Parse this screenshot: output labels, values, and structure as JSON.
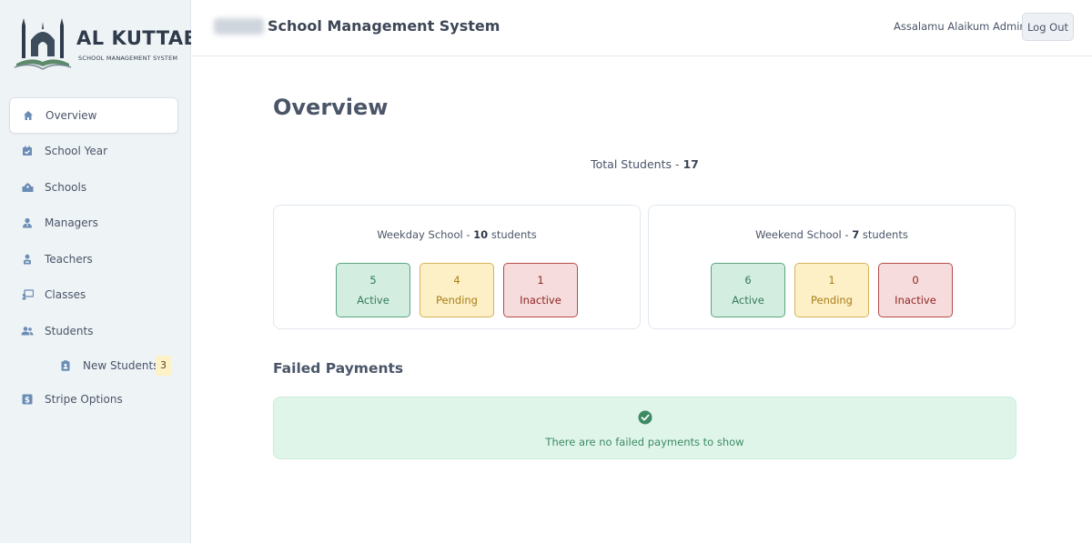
{
  "brand": {
    "name": "AL KUTTAB",
    "subtitle": "SCHOOL MANAGEMENT SYSTEM"
  },
  "sidebar": {
    "items": [
      {
        "label": "Overview",
        "icon": "home-icon",
        "active": true
      },
      {
        "label": "School Year",
        "icon": "calendar-icon"
      },
      {
        "label": "Schools",
        "icon": "school-icon"
      },
      {
        "label": "Managers",
        "icon": "user-tie-icon"
      },
      {
        "label": "Teachers",
        "icon": "teacher-icon"
      },
      {
        "label": "Classes",
        "icon": "chalkboard-icon"
      },
      {
        "label": "Students",
        "icon": "users-icon"
      },
      {
        "label": "New Students",
        "icon": "clipboard-user-icon",
        "badge": "3",
        "sub": true
      },
      {
        "label": "Stripe Options",
        "icon": "dollar-icon"
      }
    ]
  },
  "header": {
    "title": "School Management System",
    "greeting": "Assalamu Alaikum Admin",
    "logout_label": "Log Out"
  },
  "overview": {
    "title": "Overview",
    "total_label": "Total Students - ",
    "total_value": "17",
    "weekday": {
      "label": "Weekday School - ",
      "count": "10",
      "suffix": " students",
      "active": "5",
      "pending": "4",
      "inactive": "1"
    },
    "weekend": {
      "label": "Weekend School - ",
      "count": "7",
      "suffix": " students",
      "active": "6",
      "pending": "1",
      "inactive": "0"
    },
    "status_labels": {
      "active": "Active",
      "pending": "Pending",
      "inactive": "Inactive"
    }
  },
  "failed_payments": {
    "title": "Failed Payments",
    "empty_message": "There are no failed payments to show"
  },
  "colors": {
    "active_bg": "#d3eee1",
    "pending_bg": "#fdf0c7",
    "inactive_bg": "#f6dcdc",
    "success": "#3d8a63"
  }
}
